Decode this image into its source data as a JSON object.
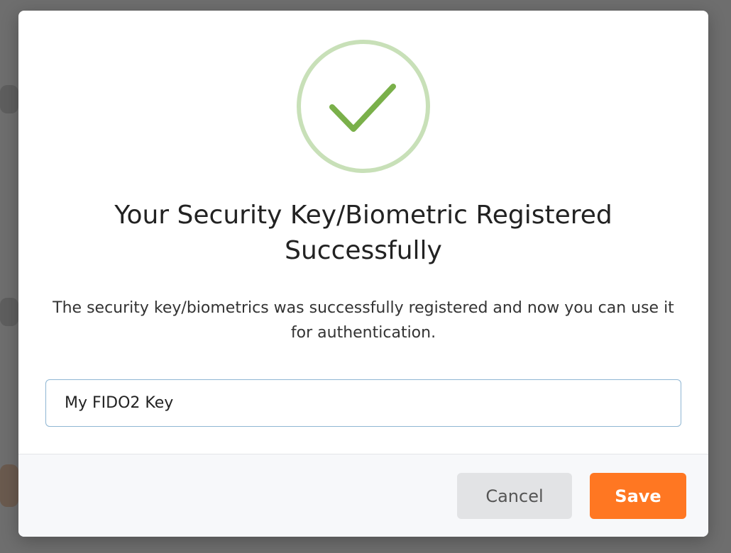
{
  "dialog": {
    "title": "Your Security Key/Biometric Registered Successfully",
    "description": "The security key/biometrics was successfully registered and now you can use it for authentication.",
    "key_name_value": "My FIDO2 Key",
    "icon": "checkmark-circle-icon",
    "cancel_label": "Cancel",
    "save_label": "Save"
  },
  "colors": {
    "accent": "#ff7722",
    "success_ring": "#c8e0b8",
    "success_check": "#7ab04a",
    "overlay": "#6e6e6e"
  }
}
